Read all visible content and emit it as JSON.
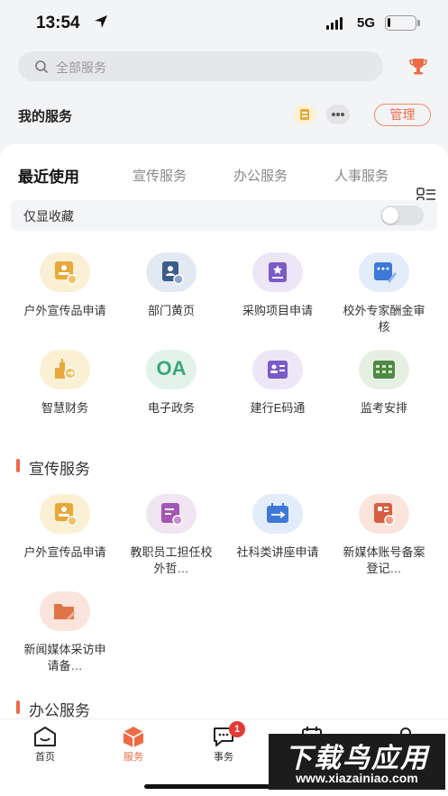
{
  "status_bar": {
    "time": "13:54",
    "network": "5G",
    "battery_level": 0.12
  },
  "search": {
    "placeholder": "全部服务"
  },
  "my_services": {
    "title": "我的服务",
    "manage_label": "管理"
  },
  "tabs": [
    {
      "label": "最近使用",
      "active": true
    },
    {
      "label": "宣传服务"
    },
    {
      "label": "办公服务"
    },
    {
      "label": "人事服务"
    }
  ],
  "favorites_only": {
    "label": "仅显收藏",
    "on": false
  },
  "recent": [
    {
      "label": "户外宣传品申请",
      "icon": "billboard-icon",
      "bg": "#fbf0d4",
      "fg": "#e6a93a"
    },
    {
      "label": "部门黄页",
      "icon": "contacts-book-icon",
      "bg": "#e3e9f3",
      "fg": "#3e5c8a"
    },
    {
      "label": "采购项目申请",
      "icon": "purchase-doc-icon",
      "bg": "#ece6f7",
      "fg": "#7a5bc7"
    },
    {
      "label": "校外专家酬金审核",
      "icon": "expert-pay-icon",
      "bg": "#e2ecfa",
      "fg": "#3f79d8"
    },
    {
      "label": "智慧财务",
      "icon": "finance-building-icon",
      "bg": "#fbf0d4",
      "fg": "#e6a93a"
    },
    {
      "label": "电子政务",
      "icon": "oa-icon",
      "bg": "#e3f3ec",
      "fg": "#3aa77a",
      "text": "OA"
    },
    {
      "label": "建行E码通",
      "icon": "id-card-icon",
      "bg": "#ece6f7",
      "fg": "#7a5bc7"
    },
    {
      "label": "监考安排",
      "icon": "calendar-grid-icon",
      "bg": "#e5f0e3",
      "fg": "#4f8a45"
    }
  ],
  "publicity_section": {
    "title": "宣传服务",
    "items": [
      {
        "label": "户外宣传品申请",
        "icon": "billboard-icon",
        "bg": "#fbf0d4",
        "fg": "#e6a93a"
      },
      {
        "label": "教职员工担任校外哲…",
        "icon": "staff-doc-icon",
        "bg": "#f1e5f3",
        "fg": "#a356b5"
      },
      {
        "label": "社科类讲座申请",
        "icon": "lecture-calendar-icon",
        "bg": "#e2ecfa",
        "fg": "#3f79d8"
      },
      {
        "label": "新媒体账号备案登记…",
        "icon": "media-account-icon",
        "bg": "#fbe4dc",
        "fg": "#d85d43"
      },
      {
        "label": "新闻媒体采访申请备…",
        "icon": "folder-edit-icon",
        "bg": "#fbe4dc",
        "fg": "#e07448"
      }
    ]
  },
  "office_section": {
    "title": "办公服务"
  },
  "bottom_nav": [
    {
      "label": "首页"
    },
    {
      "label": "服务",
      "active": true
    },
    {
      "label": "事务",
      "badge": "1"
    },
    {
      "label": ""
    },
    {
      "label": ""
    }
  ],
  "watermark": {
    "line1": "下载鸟应用",
    "line2": "www.xiazainiao.com"
  }
}
